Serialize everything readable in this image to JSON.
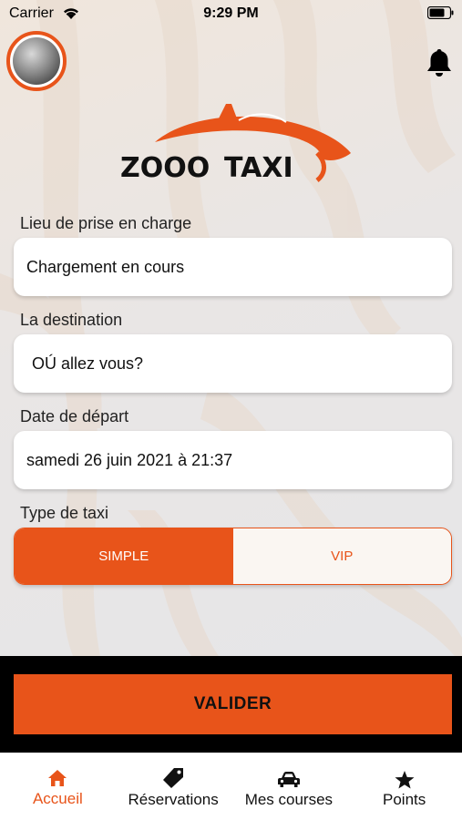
{
  "status_bar": {
    "carrier": "Carrier",
    "time": "9:29 PM"
  },
  "brand": {
    "name_part1": "ZOOO",
    "name_part2": "TAXI",
    "accent_color": "#e8541a"
  },
  "form": {
    "pickup": {
      "label": "Lieu de prise en charge",
      "value": "Chargement en cours"
    },
    "destination": {
      "label": "La destination",
      "value": "OÚ allez vous?"
    },
    "departure": {
      "label": "Date de départ",
      "value": "samedi 26 juin 2021 à 21:37"
    },
    "taxi_type": {
      "label": "Type de taxi",
      "options": [
        "SIMPLE",
        "VIP"
      ],
      "selected": "SIMPLE"
    }
  },
  "action": {
    "submit_label": "VALIDER"
  },
  "tabs": [
    {
      "label": "Accueil",
      "icon": "home-icon",
      "active": true
    },
    {
      "label": "Réservations",
      "icon": "tag-icon",
      "active": false
    },
    {
      "label": "Mes courses",
      "icon": "car-icon",
      "active": false
    },
    {
      "label": "Points",
      "icon": "star-icon",
      "active": false
    }
  ]
}
